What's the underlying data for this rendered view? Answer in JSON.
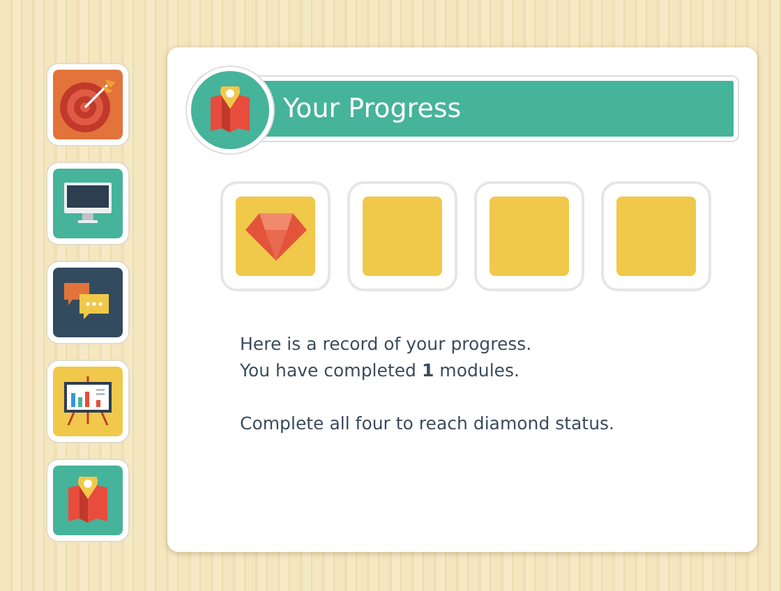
{
  "sidebar": {
    "items": [
      {
        "kind": "target",
        "color": "#e2733a"
      },
      {
        "kind": "monitor",
        "color": "#46b39b"
      },
      {
        "kind": "chat",
        "color": "#334b5e"
      },
      {
        "kind": "chart",
        "color": "#f0c84a"
      },
      {
        "kind": "map",
        "color": "#46b39b"
      }
    ]
  },
  "panel": {
    "title": "Your Progress",
    "badges": [
      {
        "earned": true
      },
      {
        "earned": false
      },
      {
        "earned": false
      },
      {
        "earned": false
      }
    ],
    "lines": [
      "Here is a record of your progress.",
      "You have completed **1** modules."
    ],
    "note": "Complete all four to reach diamond status."
  }
}
